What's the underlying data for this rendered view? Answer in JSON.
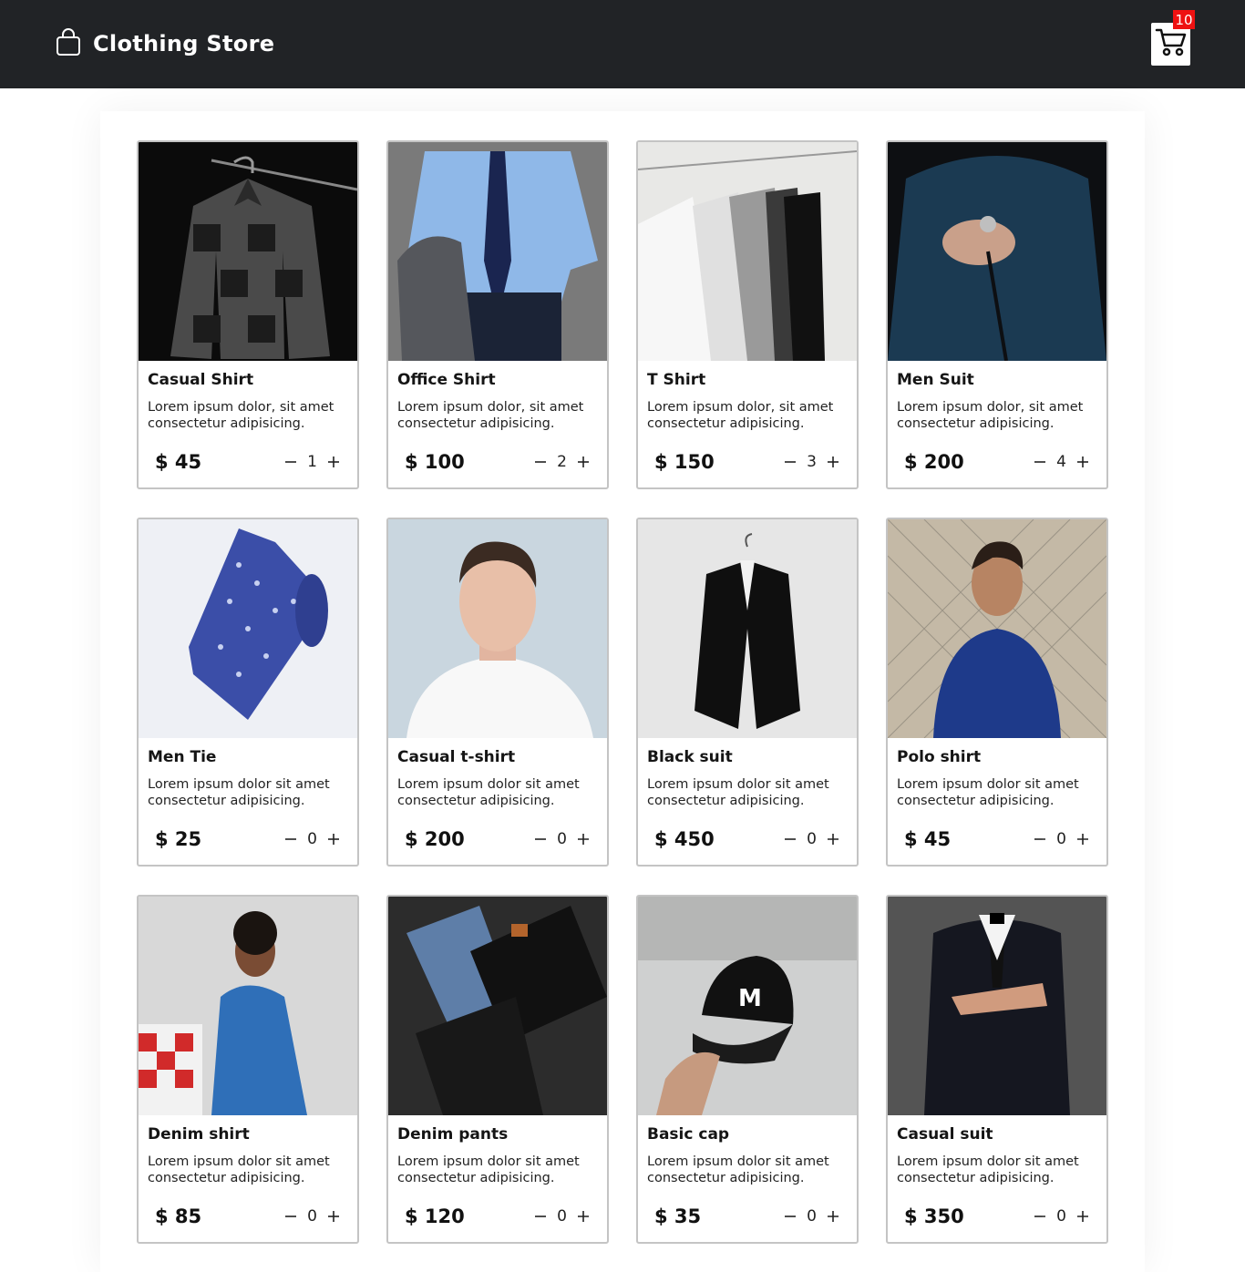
{
  "header": {
    "title": "Clothing Store",
    "brand_icon": "shopping-bag-icon",
    "cart_icon": "cart-icon",
    "cart_count": "10"
  },
  "colors": {
    "header_bg": "#212326",
    "badge_bg": "#ee1111",
    "card_border": "#c4c4c4"
  },
  "products": [
    {
      "title": "Casual Shirt",
      "desc": "Lorem ipsum dolor, sit amet consectetur adipisicing.",
      "price": "$ 45",
      "qty": "1",
      "image": "plaid-shirt-on-hanger"
    },
    {
      "title": "Office Shirt",
      "desc": "Lorem ipsum dolor, sit amet consectetur adipisicing.",
      "price": "$ 100",
      "qty": "2",
      "image": "blue-shirt-and-tie"
    },
    {
      "title": "T Shirt",
      "desc": "Lorem ipsum dolor, sit amet consectetur adipisicing.",
      "price": "$ 150",
      "qty": "3",
      "image": "shirts-on-hangers"
    },
    {
      "title": "Men Suit",
      "desc": "Lorem ipsum dolor, sit amet consectetur adipisicing.",
      "price": "$ 200",
      "qty": "4",
      "image": "man-in-navy-suit"
    },
    {
      "title": "Men Tie",
      "desc": "Lorem ipsum dolor sit amet consectetur adipisicing.",
      "price": "$ 25",
      "qty": "0",
      "image": "blue-patterned-tie"
    },
    {
      "title": "Casual t-shirt",
      "desc": "Lorem ipsum dolor sit amet consectetur adipisicing.",
      "price": "$ 200",
      "qty": "0",
      "image": "man-in-white-tshirt"
    },
    {
      "title": "Black suit",
      "desc": "Lorem ipsum dolor sit amet consectetur adipisicing.",
      "price": "$ 450",
      "qty": "0",
      "image": "black-suit-on-hanger"
    },
    {
      "title": "Polo shirt",
      "desc": "Lorem ipsum dolor sit amet consectetur adipisicing.",
      "price": "$ 45",
      "qty": "0",
      "image": "man-in-polo-shirt"
    },
    {
      "title": "Denim shirt",
      "desc": "Lorem ipsum dolor sit amet consectetur adipisicing.",
      "price": "$ 85",
      "qty": "0",
      "image": "man-in-denim-jacket"
    },
    {
      "title": "Denim pants",
      "desc": "Lorem ipsum dolor sit amet consectetur adipisicing.",
      "price": "$ 120",
      "qty": "0",
      "image": "folded-jeans"
    },
    {
      "title": "Basic cap",
      "desc": "Lorem ipsum dolor sit amet consectetur adipisicing.",
      "price": "$ 35",
      "qty": "0",
      "image": "black-cap-in-hand"
    },
    {
      "title": "Casual suit",
      "desc": "Lorem ipsum dolor sit amet consectetur adipisicing.",
      "price": "$ 350",
      "qty": "0",
      "image": "man-in-dark-suit"
    }
  ]
}
